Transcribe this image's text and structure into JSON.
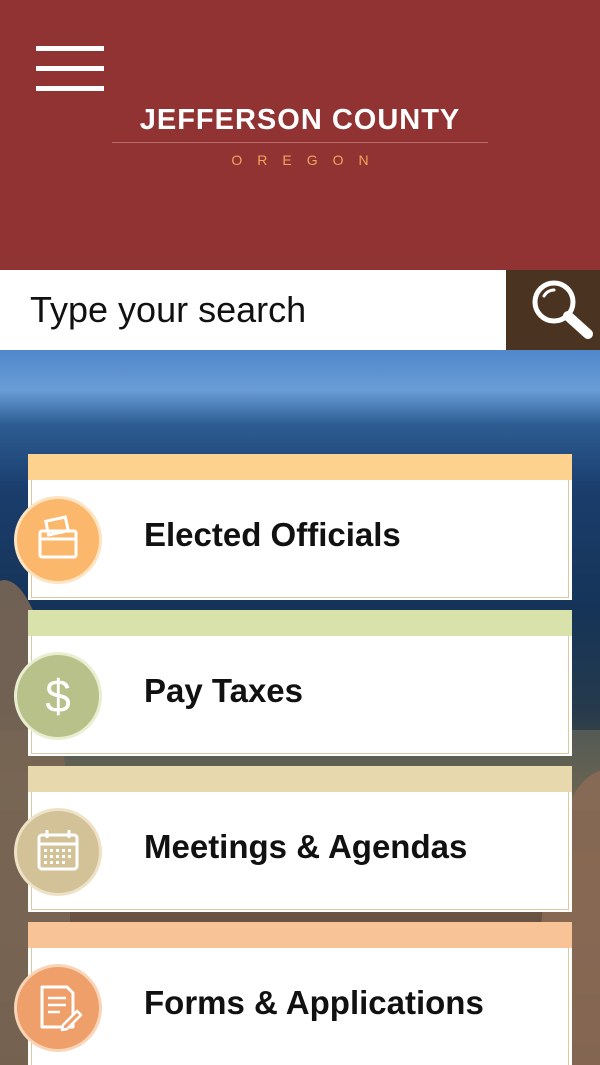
{
  "header": {
    "title": "JEFFERSON COUNTY",
    "subtitle": "OREGON",
    "background_color": "#923333",
    "menu_icon": "hamburger-menu-icon"
  },
  "search": {
    "placeholder": "Type your search",
    "value": "",
    "button_icon": "search-icon",
    "button_color": "#4b3322"
  },
  "tiles": [
    {
      "label": "Elected Officials",
      "icon": "ballot-box-icon",
      "band_color": "#fdd28e",
      "circle_color": "#fbb76b"
    },
    {
      "label": "Pay Taxes",
      "icon": "dollar-icon",
      "band_color": "#d8e2aa",
      "circle_color": "#b8c18a"
    },
    {
      "label": "Meetings & Agendas",
      "icon": "calendar-icon",
      "band_color": "#e8d8ae",
      "circle_color": "#d3c197"
    },
    {
      "label": "Forms & Applications",
      "icon": "document-edit-icon",
      "band_color": "#f8c397",
      "circle_color": "#ee9f6a"
    }
  ]
}
